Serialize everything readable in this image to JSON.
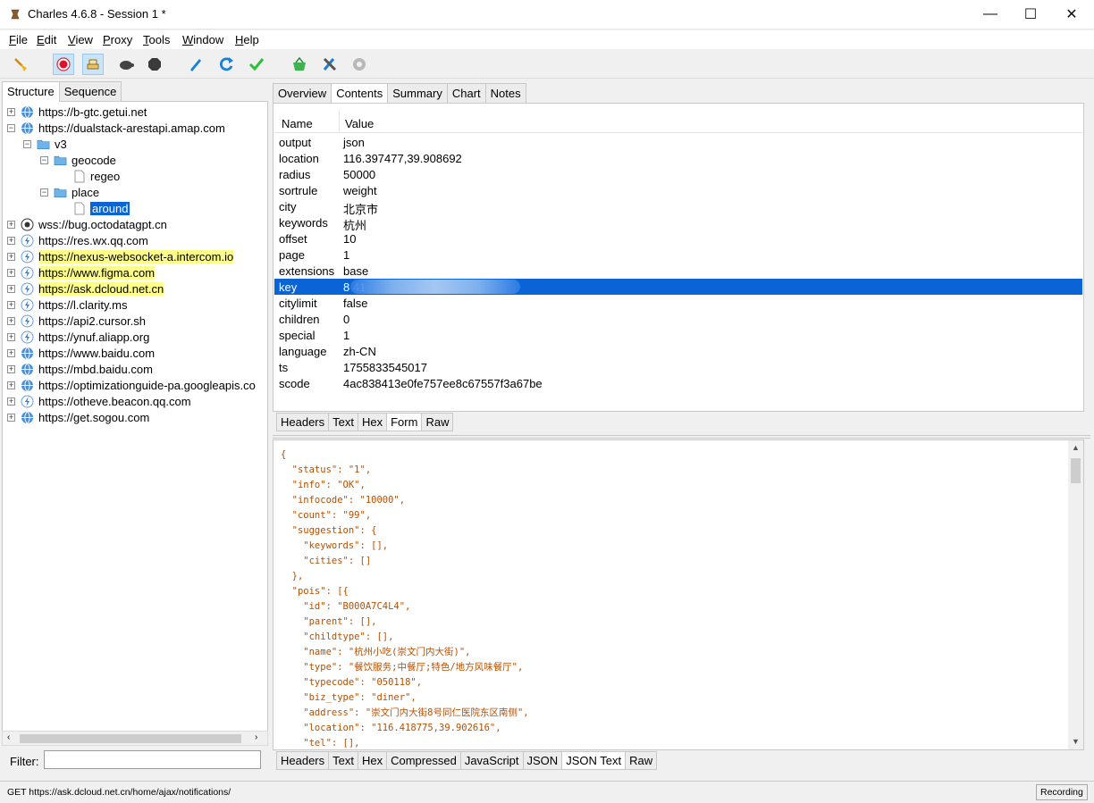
{
  "window": {
    "title": "Charles 4.6.8 - Session 1 *",
    "controls": {
      "minimize": "—",
      "maximize": "☐",
      "close": "✕"
    }
  },
  "menu": [
    {
      "label": "File",
      "key": "F",
      "rest": "ile"
    },
    {
      "label": "Edit",
      "key": "E",
      "rest": "dit"
    },
    {
      "label": "View",
      "key": "V",
      "rest": "iew"
    },
    {
      "label": "Proxy",
      "key": "P",
      "rest": "roxy"
    },
    {
      "label": "Tools",
      "key": "T",
      "rest": "ools"
    },
    {
      "label": "Window",
      "key": "W",
      "rest": "indow"
    },
    {
      "label": "Help",
      "key": "H",
      "rest": "elp"
    }
  ],
  "toolbar": {
    "icons": [
      "broom-icon",
      "record-icon",
      "throttle-icon",
      "turtle-icon",
      "stop-hexagon-icon",
      "pen-icon",
      "refresh-icon",
      "check-icon",
      "basket-icon",
      "tools-icon",
      "gear-icon"
    ],
    "accent_record": "#e0102a",
    "accent_blue": "#1a7fd6",
    "accent_green": "#2fbf3c"
  },
  "left_tabs": {
    "structure": "Structure",
    "sequence": "Sequence"
  },
  "tree": {
    "hosts": [
      {
        "label": "https://b-gtc.getui.net",
        "icon": "globe-icon"
      },
      {
        "label": "https://dualstack-arestapi.amap.com",
        "icon": "globe-icon"
      },
      {
        "label": "wss://bug.octodatagpt.cn",
        "icon": "ws-icon"
      },
      {
        "label": "https://res.wx.qq.com",
        "icon": "lightning-icon"
      },
      {
        "label": "https://nexus-websocket-a.intercom.io",
        "icon": "lightning-icon"
      },
      {
        "label": "https://www.figma.com",
        "icon": "lightning-icon"
      },
      {
        "label": "https://ask.dcloud.net.cn",
        "icon": "lightning-icon"
      },
      {
        "label": "https://l.clarity.ms",
        "icon": "lightning-icon"
      },
      {
        "label": "https://api2.cursor.sh",
        "icon": "lightning-icon"
      },
      {
        "label": "https://ynuf.aliapp.org",
        "icon": "lightning-icon"
      },
      {
        "label": "https://www.baidu.com",
        "icon": "globe-icon"
      },
      {
        "label": "https://mbd.baidu.com",
        "icon": "globe-icon"
      },
      {
        "label": "https://optimizationguide-pa.googleapis.co",
        "icon": "globe-icon"
      },
      {
        "label": "https://otheve.beacon.qq.com",
        "icon": "lightning-icon"
      },
      {
        "label": "https://get.sogou.com",
        "icon": "globe-icon"
      }
    ],
    "folders": {
      "v3": "v3",
      "geocode": "geocode",
      "regeo": "regeo",
      "place": "place",
      "around": "around"
    }
  },
  "filter": {
    "label": "Filter:",
    "value": ""
  },
  "right_tabs": [
    "Overview",
    "Contents",
    "Summary",
    "Chart",
    "Notes"
  ],
  "params": {
    "header_name": "Name",
    "header_value": "Value",
    "rows": [
      {
        "name": "output",
        "value": "json"
      },
      {
        "name": "location",
        "value": "116.397477,39.908692"
      },
      {
        "name": "radius",
        "value": "50000"
      },
      {
        "name": "sortrule",
        "value": "weight"
      },
      {
        "name": "city",
        "value": "北京市"
      },
      {
        "name": "keywords",
        "value": "杭州"
      },
      {
        "name": "offset",
        "value": "10"
      },
      {
        "name": "page",
        "value": "1"
      },
      {
        "name": "extensions",
        "value": "base"
      },
      {
        "name": "key",
        "value": "8                              41"
      },
      {
        "name": "citylimit",
        "value": "false"
      },
      {
        "name": "children",
        "value": "0"
      },
      {
        "name": "special",
        "value": "1"
      },
      {
        "name": "language",
        "value": "zh-CN"
      },
      {
        "name": "ts",
        "value": "1755833545017"
      },
      {
        "name": "scode",
        "value": "4ac838413e0fe757ee8c67557f3a67be"
      }
    ]
  },
  "request_tabs": [
    "Headers",
    "Text",
    "Hex",
    "Form",
    "Raw"
  ],
  "response_tabs": [
    "Headers",
    "Text",
    "Hex",
    "Compressed",
    "JavaScript",
    "JSON",
    "JSON Text",
    "Raw"
  ],
  "json_text": "{\n  \"status\": \"1\",\n  \"info\": \"OK\",\n  \"infocode\": \"10000\",\n  \"count\": \"99\",\n  \"suggestion\": {\n    \"keywords\": [],\n    \"cities\": []\n  },\n  \"pois\": [{\n    \"id\": \"B000A7C4L4\",\n    \"parent\": [],\n    \"childtype\": [],\n    \"name\": \"杭州小吃(崇文门内大街)\",\n    \"type\": \"餐饮服务;中餐厅;特色/地方风味餐厅\",\n    \"typecode\": \"050118\",\n    \"biz_type\": \"diner\",\n    \"address\": \"崇文门内大街8号同仁医院东区南侧\",\n    \"location\": \"116.418775,39.902616\",\n    \"tel\": [],",
  "status": {
    "text": "GET https://ask.dcloud.net.cn/home/ajax/notifications/",
    "recording": "Recording"
  }
}
